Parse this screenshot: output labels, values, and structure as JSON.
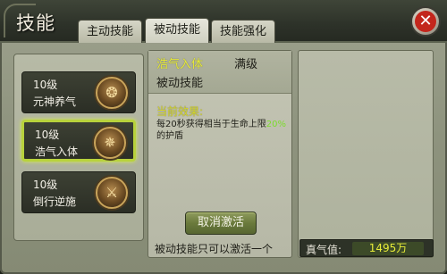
{
  "window": {
    "title": "技能"
  },
  "tabs": [
    {
      "label": "主动技能",
      "active": false
    },
    {
      "label": "被动技能",
      "active": true
    },
    {
      "label": "技能强化",
      "active": false
    }
  ],
  "close_button": {
    "icon": "close-icon",
    "glyph": "✕"
  },
  "skills": [
    {
      "level": "10级",
      "name": "元神养气",
      "icon": "skill-yuanshen-icon",
      "selected": false
    },
    {
      "level": "10级",
      "name": "浩气入体",
      "icon": "skill-haoqi-icon",
      "selected": true
    },
    {
      "level": "10级",
      "name": "倒行逆施",
      "icon": "skill-daoxing-icon",
      "selected": false
    }
  ],
  "detail": {
    "skill_name": "浩气入体",
    "level_status": "满级",
    "skill_type": "被动技能",
    "effect_label": "当前效果:",
    "effect_text_before": "每20秒获得相当于生命上限",
    "effect_highlight": "20%",
    "effect_text_after": "的护盾",
    "cancel_button": "取消激活",
    "note": "被动技能只可以激活一个"
  },
  "qi": {
    "label": "真气值:",
    "value": "1495万"
  },
  "colors": {
    "highlight": "#e8ec38",
    "selected_border": "#b8d23c",
    "close_red": "#c3261c"
  }
}
